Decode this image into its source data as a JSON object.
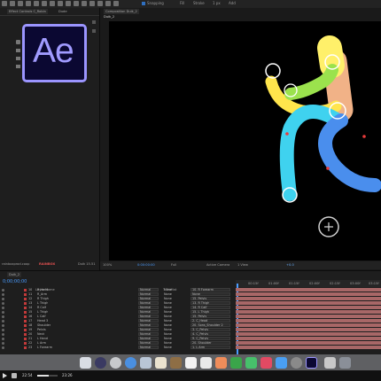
{
  "toolbar": {
    "snapping_label": "Snapping",
    "fill_label": "Fill",
    "stroke_label": "Stroke",
    "stroke_width": "1 px",
    "add_label": "Add"
  },
  "left_panel": {
    "tab_label": "Effect Controls C_Robin",
    "tab_sub": "Dude",
    "logo_text": "Ae",
    "website": "rainboxprod.coop",
    "brand": "RAINBOX",
    "bottom_label": "Duik 15.51"
  },
  "viewer": {
    "tab_label": "Composition Duik_2",
    "breadcrumb": "Duik_2",
    "zoom": "100%",
    "timecode": "0:00:00:00",
    "resolution": "Full",
    "camera": "Active Camera",
    "views": "1 View",
    "exposure": "+0.0"
  },
  "timeline": {
    "comp_tab": "Duik_2",
    "current_time": "0;00;00;00",
    "headers": {
      "layer_name": "Layer Name",
      "mode": "Mode",
      "trkmat": "T TrkMat",
      "parent": "Parent"
    },
    "layers": [
      {
        "num": "10",
        "name": "R Hand",
        "mode": "Normal",
        "trkmat": "None",
        "parent": "10. R Forearm"
      },
      {
        "num": "11",
        "name": "R_Arm",
        "mode": "Normal",
        "trkmat": "None",
        "parent": "None"
      },
      {
        "num": "12",
        "name": "R Thigh",
        "mode": "Normal",
        "trkmat": "None",
        "parent": "15. Pelvis"
      },
      {
        "num": "13",
        "name": "L Thigh",
        "mode": "Normal",
        "trkmat": "None",
        "parent": "13. R Thigh"
      },
      {
        "num": "14",
        "name": "R Calf",
        "mode": "Normal",
        "trkmat": "None",
        "parent": "14. R Calf"
      },
      {
        "num": "15",
        "name": "L Thigh",
        "mode": "Normal",
        "trkmat": "None",
        "parent": "15. L Thigh"
      },
      {
        "num": "16",
        "name": "L Calf",
        "mode": "Normal",
        "trkmat": "None",
        "parent": "15. Pelvis"
      },
      {
        "num": "17",
        "name": "Head 3",
        "mode": "Normal",
        "trkmat": "None",
        "parent": "2. C_Head"
      },
      {
        "num": "18",
        "name": "Shoulder",
        "mode": "Normal",
        "trkmat": "None",
        "parent": "20. Sons_Shoulder 2"
      },
      {
        "num": "19",
        "name": "Pelvis",
        "mode": "Normal",
        "trkmat": "None",
        "parent": "3. C_Pelvis"
      },
      {
        "num": "20",
        "name": "Neck",
        "mode": "Normal",
        "trkmat": "None",
        "parent": "4. C_Pelvis"
      },
      {
        "num": "21",
        "name": "L Hand",
        "mode": "Normal",
        "trkmat": "None",
        "parent": "9. C_Pelvis"
      },
      {
        "num": "22",
        "name": "L Arm",
        "mode": "Normal",
        "trkmat": "None",
        "parent": "20. Shoulder"
      },
      {
        "num": "23",
        "name": "L Forearm",
        "mode": "Normal",
        "trkmat": "None",
        "parent": "1. L Arm"
      }
    ],
    "ruler_marks": [
      "00:15f",
      "01:00f",
      "01:15f",
      "02:00f",
      "02:15f",
      "03:00f",
      "03:15f"
    ]
  },
  "video_player": {
    "elapsed": "22:54",
    "total": "23:26",
    "progress": 0.55
  },
  "colors": {
    "accent": "#2f6fbf",
    "layer_label": "#c23a3a",
    "bar": "#a86767",
    "logo_bg": "#0b0832",
    "logo_fg": "#9b95ff"
  }
}
